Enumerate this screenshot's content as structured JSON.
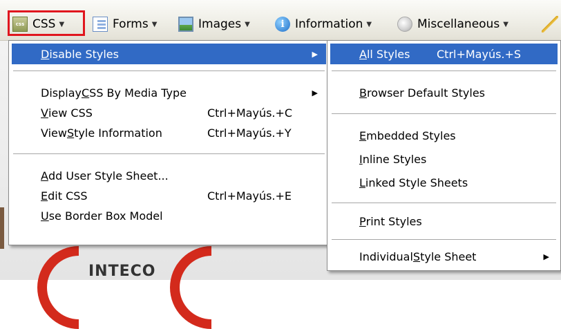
{
  "page": {
    "logo_text": "INTECO"
  },
  "toolbar": {
    "items": [
      {
        "label": "CSS",
        "icon": "css-icon"
      },
      {
        "label": "Forms",
        "icon": "forms-icon"
      },
      {
        "label": "Images",
        "icon": "images-icon"
      },
      {
        "label": "Information",
        "icon": "information-icon"
      },
      {
        "label": "Miscellaneous",
        "icon": "miscellaneous-icon"
      }
    ],
    "highlight_color": "#e0161e"
  },
  "css_menu": {
    "items": [
      {
        "pre": "",
        "u": "D",
        "post": "isable Styles",
        "shortcut": "",
        "submenu": true,
        "selected": true
      },
      {
        "pre": "Display ",
        "u": "C",
        "post": "SS By Media Type",
        "shortcut": "",
        "submenu": true
      },
      {
        "pre": "",
        "u": "V",
        "post": "iew CSS",
        "shortcut": "Ctrl+Mayús.+C"
      },
      {
        "pre": "View ",
        "u": "S",
        "post": "tyle Information",
        "shortcut": "Ctrl+Mayús.+Y"
      },
      {
        "pre": "",
        "u": "A",
        "post": "dd User Style Sheet...",
        "shortcut": ""
      },
      {
        "pre": "",
        "u": "E",
        "post": "dit CSS",
        "shortcut": "Ctrl+Mayús.+E"
      },
      {
        "pre": "",
        "u": "U",
        "post": "se Border Box Model",
        "shortcut": ""
      }
    ],
    "selection_color": "#316ac5"
  },
  "disable_styles_menu": {
    "items": [
      {
        "pre": "",
        "u": "A",
        "post": "ll Styles",
        "shortcut": "Ctrl+Mayús.+S",
        "selected": true
      },
      {
        "pre": "",
        "u": "B",
        "post": "rowser Default Styles",
        "shortcut": ""
      },
      {
        "pre": "",
        "u": "E",
        "post": "mbedded Styles",
        "shortcut": ""
      },
      {
        "pre": "",
        "u": "I",
        "post": "nline Styles",
        "shortcut": ""
      },
      {
        "pre": "",
        "u": "L",
        "post": "inked Style Sheets",
        "shortcut": ""
      },
      {
        "pre": "",
        "u": "P",
        "post": "rint Styles",
        "shortcut": ""
      },
      {
        "pre": "Individual ",
        "u": "S",
        "post": "tyle Sheet",
        "shortcut": "",
        "submenu": true
      }
    ]
  }
}
